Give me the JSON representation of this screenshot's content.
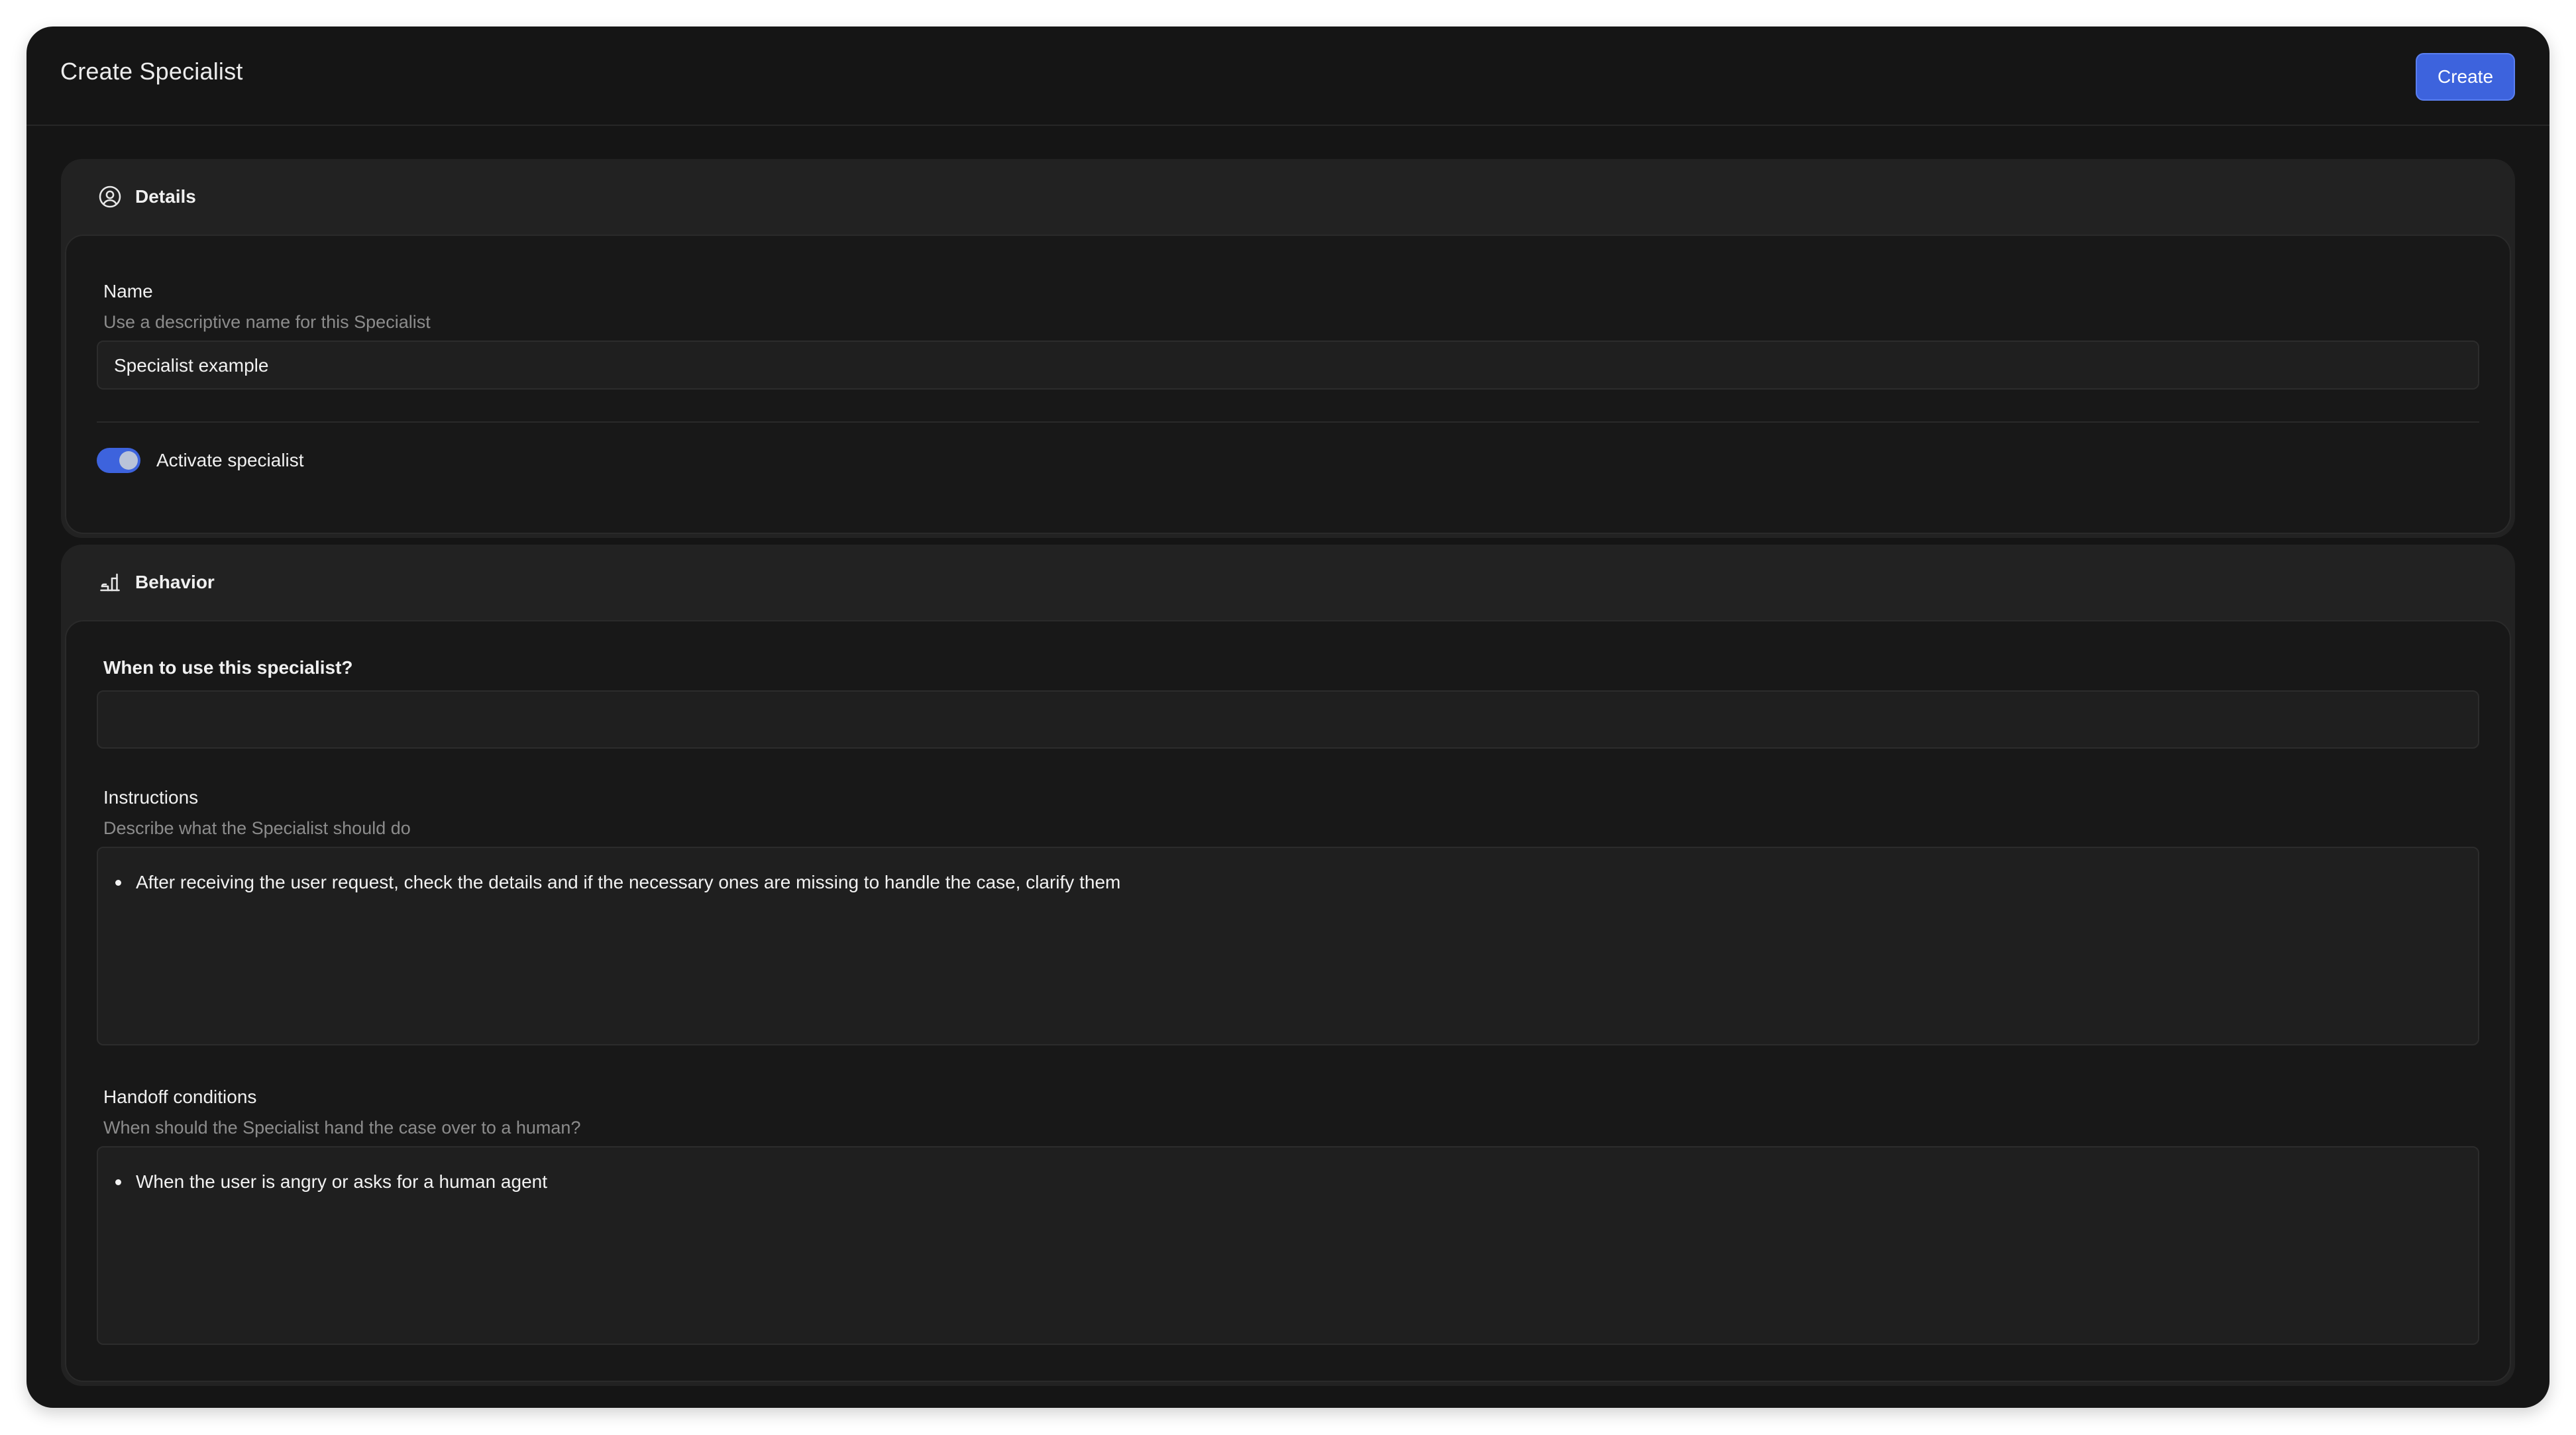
{
  "header": {
    "title": "Create Specialist",
    "create_label": "Create"
  },
  "details": {
    "section_label": "Details",
    "icon": "user-circle-icon",
    "name_label": "Name",
    "name_help": "Use a descriptive name for this Specialist",
    "name_value": "Specialist example",
    "activate_label": "Activate specialist",
    "activate_on": true
  },
  "behavior": {
    "section_label": "Behavior",
    "icon": "behavior-icon",
    "when_label": "When to use this specialist?",
    "when_value": "",
    "instructions_label": "Instructions",
    "instructions_help": "Describe what the Specialist should do",
    "instructions_items": [
      "After receiving the user request, check the details and if the necessary ones are missing to handle the case, clarify them"
    ],
    "handoff_label": "Handoff conditions",
    "handoff_help": "When should the Specialist hand the case over to a human?",
    "handoff_items": [
      "When the user is angry or asks for a human agent"
    ]
  },
  "colors": {
    "accent": "#3d63dd",
    "window_bg": "#151515",
    "card_bg": "#222222"
  }
}
